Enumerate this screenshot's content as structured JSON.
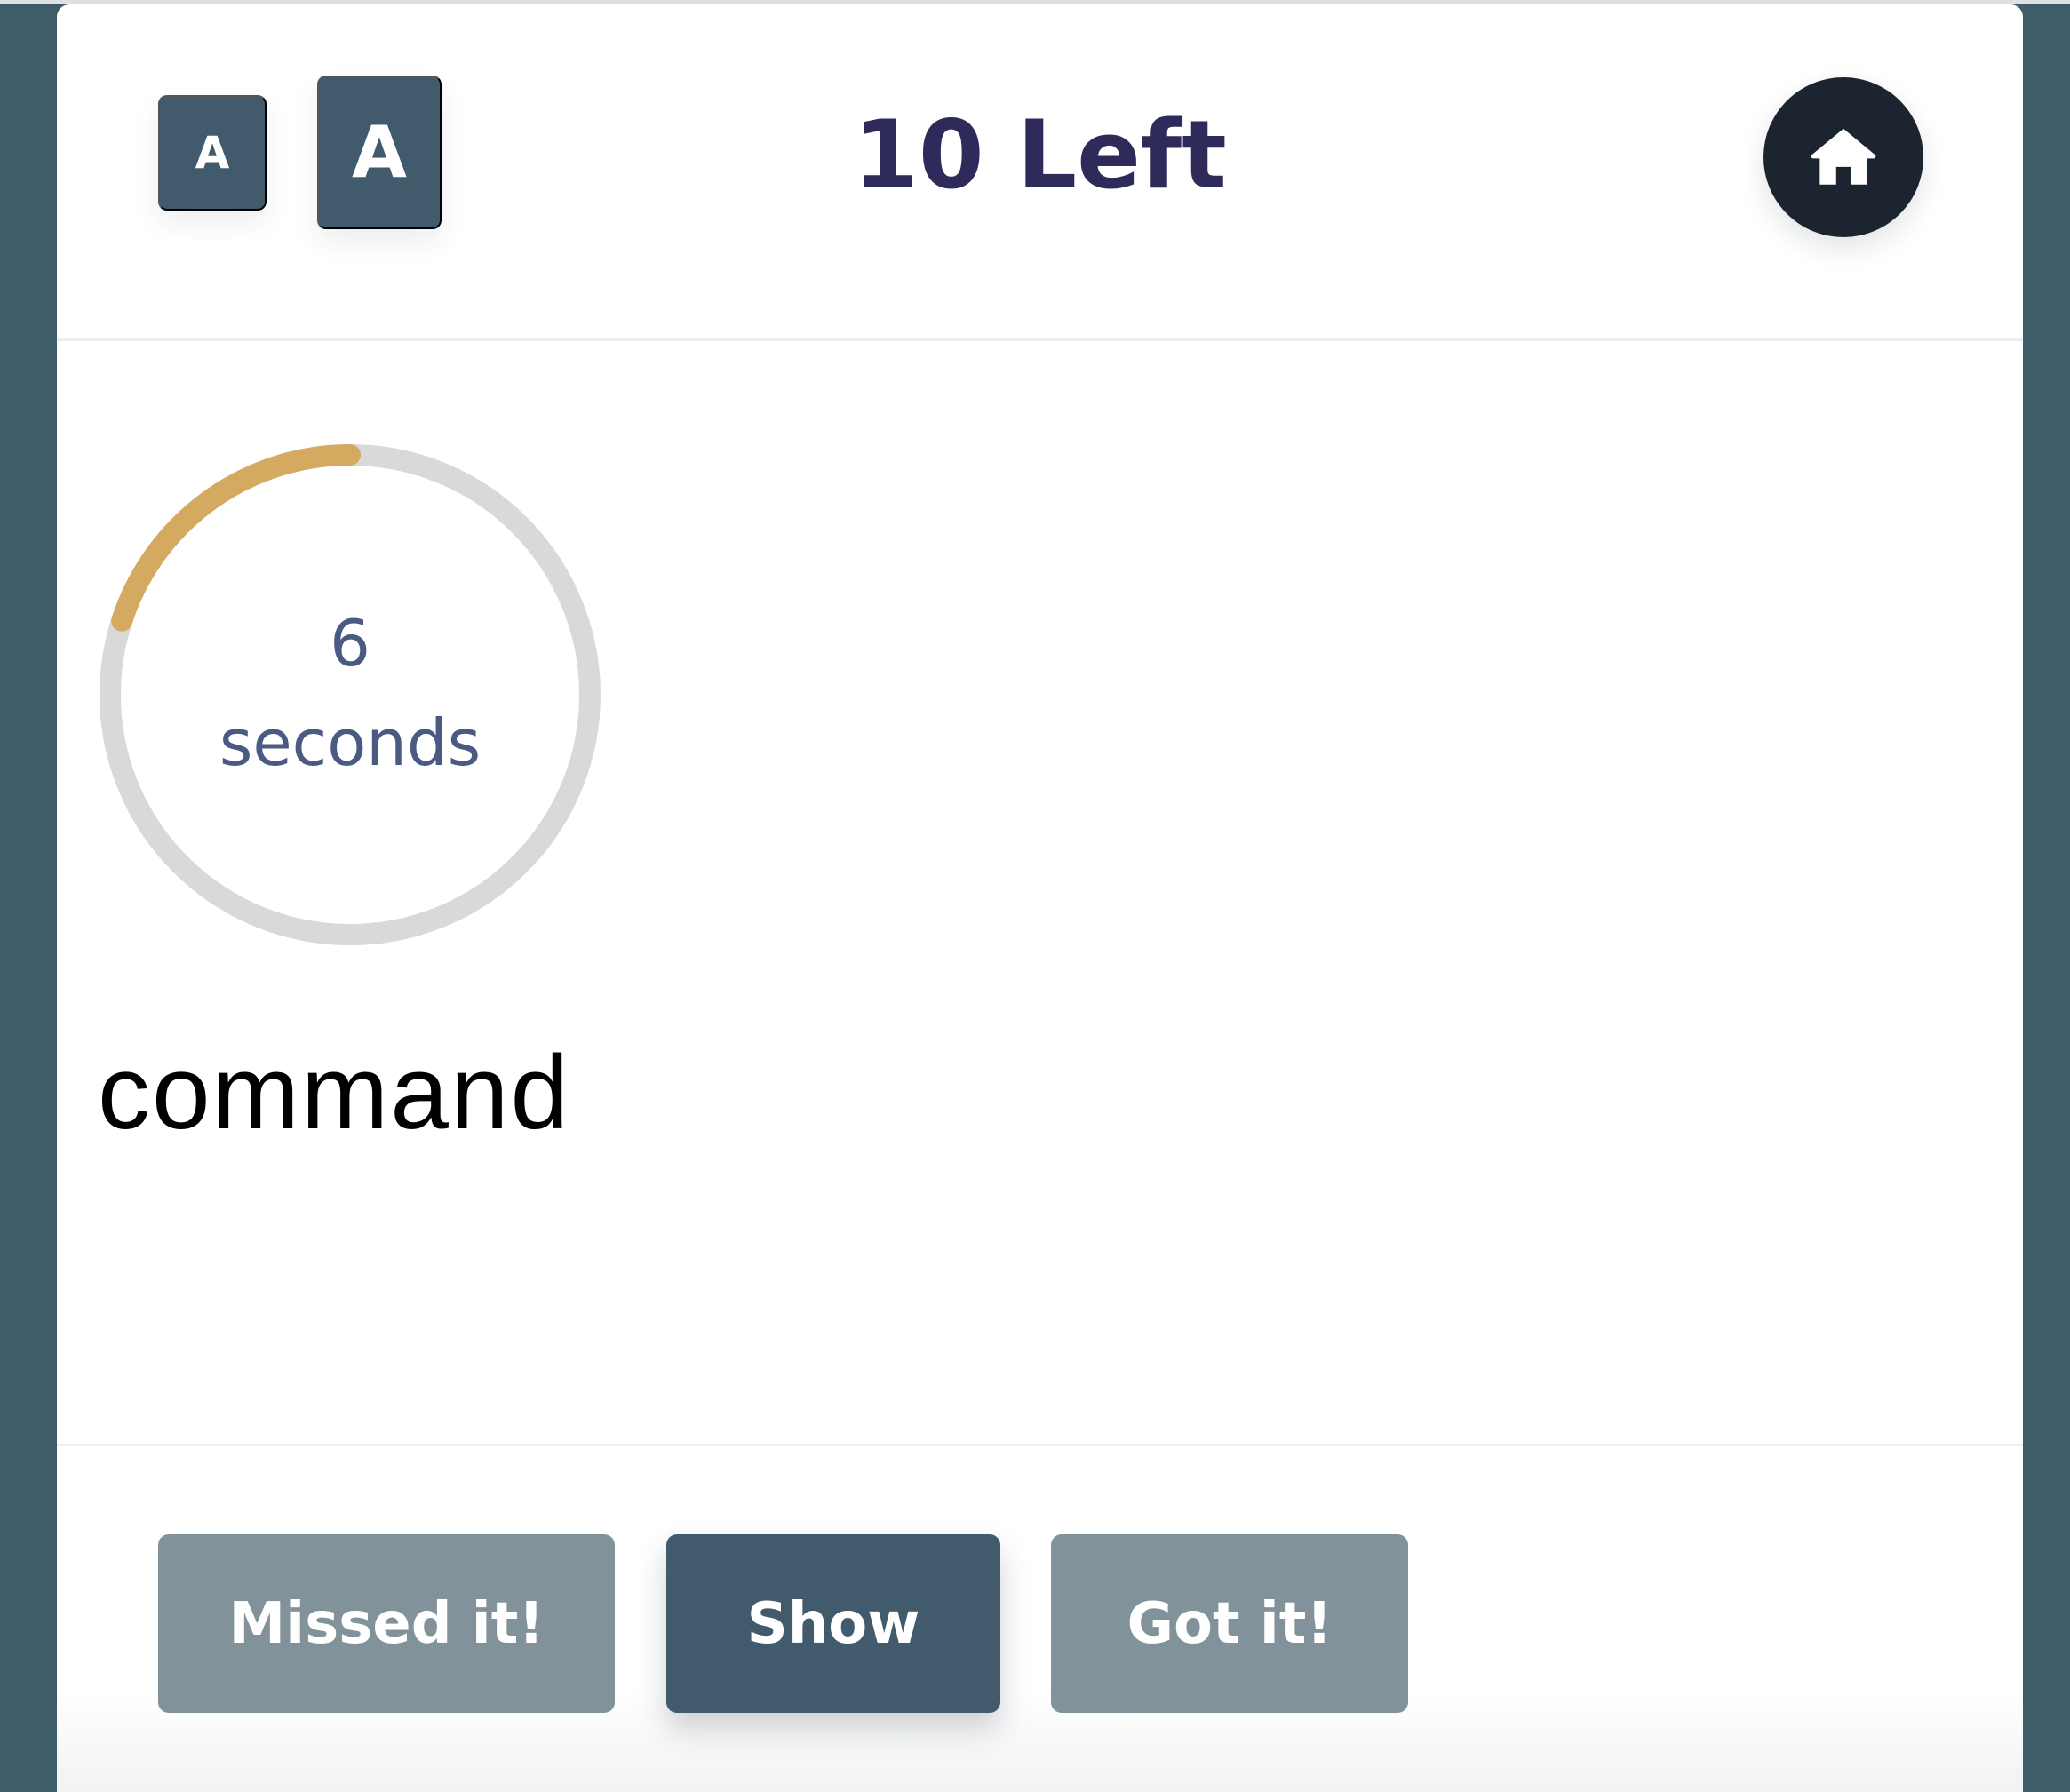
{
  "header": {
    "font_small_label": "A",
    "font_large_label": "A",
    "remaining_label": "10 Left"
  },
  "timer": {
    "value": "6",
    "unit": "seconds",
    "progress_fraction": 0.2,
    "track_color": "#d9d9d9",
    "progress_color": "#d4aa61"
  },
  "card": {
    "word": "command"
  },
  "actions": {
    "missed_label": "Missed it!",
    "show_label": "Show",
    "got_label": "Got it!"
  },
  "icons": {
    "home": "home-icon"
  },
  "colors": {
    "primary": "#415a6c",
    "muted": "#82929b",
    "title": "#2e2a5a",
    "home_bg": "#1c2430",
    "background": "#3f5c69"
  }
}
